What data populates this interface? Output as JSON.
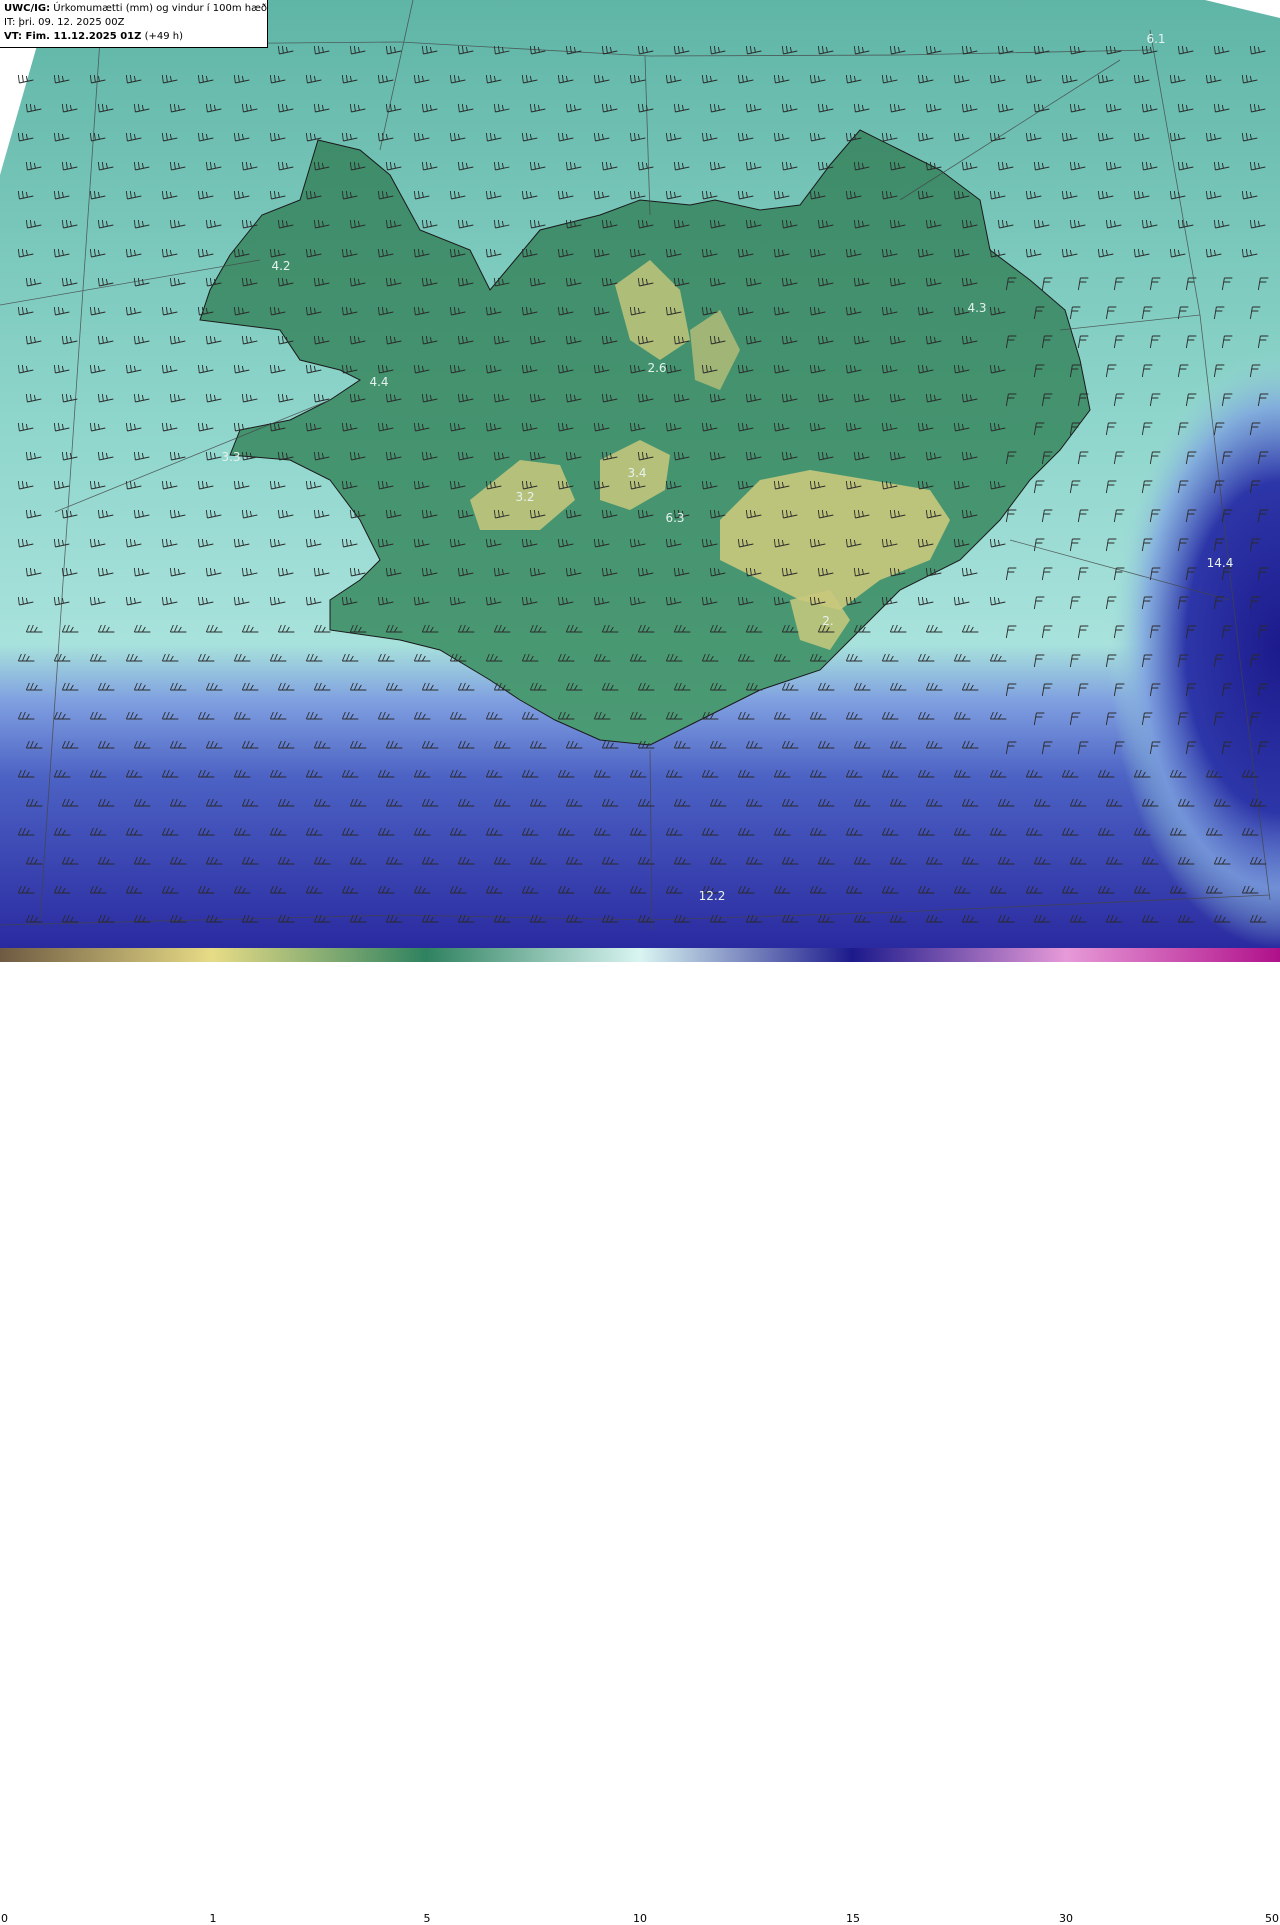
{
  "header": {
    "model_prefix": "UWC/IG:",
    "title": "Úrkomumætti (mm) og vindur í 100m hæð",
    "it_line": "IT: þri. 09. 12. 2025 00Z",
    "vt_prefix": "VT: Fim. 11.12.2025 01Z",
    "vt_suffix": "(+49 h)"
  },
  "map_labels": [
    {
      "text": "6.1"
    },
    {
      "text": "4.2"
    },
    {
      "text": "4.4"
    },
    {
      "text": "3.3"
    },
    {
      "text": "3.2"
    },
    {
      "text": "3.4"
    },
    {
      "text": "2.6"
    },
    {
      "text": "6.3"
    },
    {
      "text": "4.3"
    },
    {
      "text": "14.4"
    },
    {
      "text": "12.2"
    },
    {
      "text": "2."
    }
  ],
  "colorbar": {
    "ticks": [
      "0",
      "1",
      "5",
      "10",
      "15",
      "30",
      "50"
    ],
    "colors": {
      "c0": "#6e5a42",
      "c1": "#e7dc86",
      "c5": "#2f8260",
      "c10": "#d9f5f2",
      "c15": "#1c1a8c",
      "c30": "#e79ad8",
      "c50": "#b0108a"
    }
  },
  "palette": {
    "sea_low": "#9fdcd6",
    "sea_mid": "#7cc9bf",
    "land_green": "#3f8c6a",
    "land_yellow": "#c7c97a",
    "heavy_blue": "#22239a",
    "mid_blue": "#4b63c6",
    "coast": "#1a1a1a",
    "barb": "#2a2a2a"
  }
}
